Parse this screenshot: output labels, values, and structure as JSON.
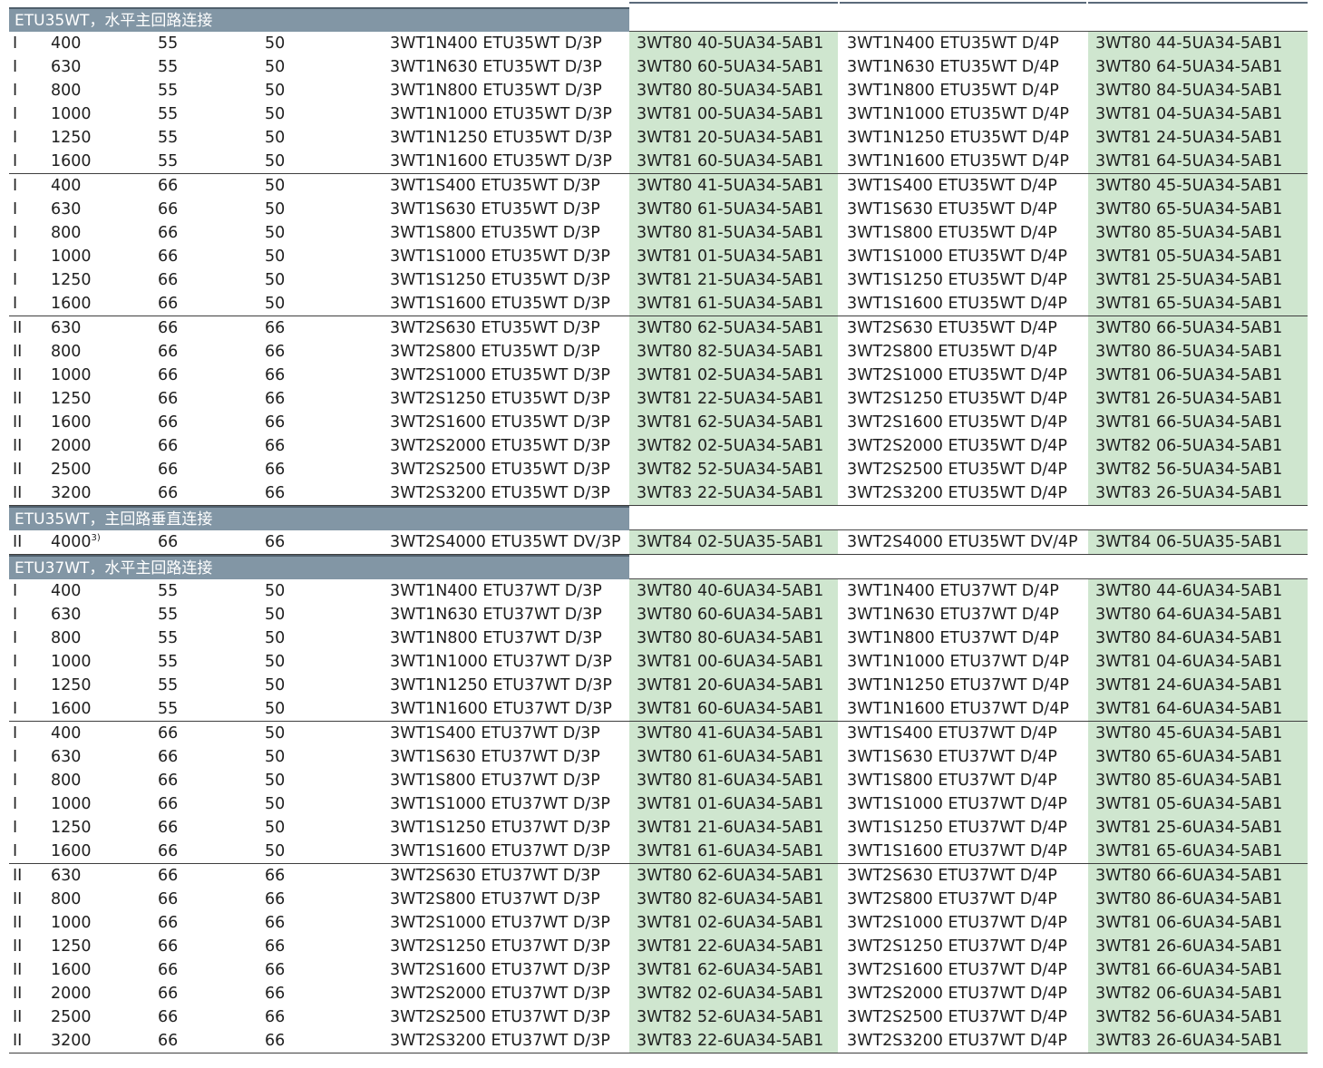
{
  "sections": [
    {
      "title": "ETU35WT，水平主回路连接",
      "groups": [
        [
          [
            "I",
            "400",
            "55",
            "50",
            "3WT1N400 ETU35WT D/3P",
            "3WT80 40-5UA34-5AB1",
            "3WT1N400 ETU35WT D/4P",
            "3WT80 44-5UA34-5AB1"
          ],
          [
            "I",
            "630",
            "55",
            "50",
            "3WT1N630 ETU35WT D/3P",
            "3WT80 60-5UA34-5AB1",
            "3WT1N630 ETU35WT D/4P",
            "3WT80 64-5UA34-5AB1"
          ],
          [
            "I",
            "800",
            "55",
            "50",
            "3WT1N800 ETU35WT D/3P",
            "3WT80 80-5UA34-5AB1",
            "3WT1N800 ETU35WT D/4P",
            "3WT80 84-5UA34-5AB1"
          ],
          [
            "I",
            "1000",
            "55",
            "50",
            "3WT1N1000 ETU35WT D/3P",
            "3WT81 00-5UA34-5AB1",
            "3WT1N1000 ETU35WT D/4P",
            "3WT81 04-5UA34-5AB1"
          ],
          [
            "I",
            "1250",
            "55",
            "50",
            "3WT1N1250 ETU35WT D/3P",
            "3WT81 20-5UA34-5AB1",
            "3WT1N1250 ETU35WT D/4P",
            "3WT81 24-5UA34-5AB1"
          ],
          [
            "I",
            "1600",
            "55",
            "50",
            "3WT1N1600 ETU35WT D/3P",
            "3WT81 60-5UA34-5AB1",
            "3WT1N1600 ETU35WT D/4P",
            "3WT81 64-5UA34-5AB1"
          ]
        ],
        [
          [
            "I",
            "400",
            "66",
            "50",
            "3WT1S400 ETU35WT D/3P",
            "3WT80 41-5UA34-5AB1",
            "3WT1S400 ETU35WT D/4P",
            "3WT80 45-5UA34-5AB1"
          ],
          [
            "I",
            "630",
            "66",
            "50",
            "3WT1S630 ETU35WT D/3P",
            "3WT80 61-5UA34-5AB1",
            "3WT1S630 ETU35WT D/4P",
            "3WT80 65-5UA34-5AB1"
          ],
          [
            "I",
            "800",
            "66",
            "50",
            "3WT1S800 ETU35WT D/3P",
            "3WT80 81-5UA34-5AB1",
            "3WT1S800 ETU35WT D/4P",
            "3WT80 85-5UA34-5AB1"
          ],
          [
            "I",
            "1000",
            "66",
            "50",
            "3WT1S1000 ETU35WT D/3P",
            "3WT81 01-5UA34-5AB1",
            "3WT1S1000 ETU35WT D/4P",
            "3WT81 05-5UA34-5AB1"
          ],
          [
            "I",
            "1250",
            "66",
            "50",
            "3WT1S1250 ETU35WT D/3P",
            "3WT81 21-5UA34-5AB1",
            "3WT1S1250 ETU35WT D/4P",
            "3WT81 25-5UA34-5AB1"
          ],
          [
            "I",
            "1600",
            "66",
            "50",
            "3WT1S1600 ETU35WT D/3P",
            "3WT81 61-5UA34-5AB1",
            "3WT1S1600 ETU35WT D/4P",
            "3WT81 65-5UA34-5AB1"
          ]
        ],
        [
          [
            "II",
            "630",
            "66",
            "66",
            "3WT2S630 ETU35WT D/3P",
            "3WT80 62-5UA34-5AB1",
            "3WT2S630 ETU35WT D/4P",
            "3WT80 66-5UA34-5AB1"
          ],
          [
            "II",
            "800",
            "66",
            "66",
            "3WT2S800 ETU35WT D/3P",
            "3WT80 82-5UA34-5AB1",
            "3WT2S800 ETU35WT D/4P",
            "3WT80 86-5UA34-5AB1"
          ],
          [
            "II",
            "1000",
            "66",
            "66",
            "3WT2S1000 ETU35WT D/3P",
            "3WT81 02-5UA34-5AB1",
            "3WT2S1000 ETU35WT D/4P",
            "3WT81 06-5UA34-5AB1"
          ],
          [
            "II",
            "1250",
            "66",
            "66",
            "3WT2S1250 ETU35WT D/3P",
            "3WT81 22-5UA34-5AB1",
            "3WT2S1250 ETU35WT D/4P",
            "3WT81 26-5UA34-5AB1"
          ],
          [
            "II",
            "1600",
            "66",
            "66",
            "3WT2S1600 ETU35WT D/3P",
            "3WT81 62-5UA34-5AB1",
            "3WT2S1600 ETU35WT D/4P",
            "3WT81 66-5UA34-5AB1"
          ],
          [
            "II",
            "2000",
            "66",
            "66",
            "3WT2S2000 ETU35WT D/3P",
            "3WT82 02-5UA34-5AB1",
            "3WT2S2000 ETU35WT D/4P",
            "3WT82 06-5UA34-5AB1"
          ],
          [
            "II",
            "2500",
            "66",
            "66",
            "3WT2S2500 ETU35WT D/3P",
            "3WT82 52-5UA34-5AB1",
            "3WT2S2500 ETU35WT D/4P",
            "3WT82 56-5UA34-5AB1"
          ],
          [
            "II",
            "3200",
            "66",
            "66",
            "3WT2S3200 ETU35WT D/3P",
            "3WT83 22-5UA34-5AB1",
            "3WT2S3200 ETU35WT D/4P",
            "3WT83 26-5UA34-5AB1"
          ]
        ]
      ]
    },
    {
      "title": "ETU35WT，主回路垂直连接",
      "groups": [
        [
          [
            "II",
            "4000",
            "66",
            "66",
            "3WT2S4000 ETU35WT DV/3P",
            "3WT84 02-5UA35-5AB1",
            "3WT2S4000 ETU35WT DV/4P",
            "3WT84 06-5UA35-5AB1"
          ]
        ]
      ]
    },
    {
      "title": "ETU37WT，水平主回路连接",
      "groups": [
        [
          [
            "I",
            "400",
            "55",
            "50",
            "3WT1N400 ETU37WT D/3P",
            "3WT80 40-6UA34-5AB1",
            "3WT1N400 ETU37WT D/4P",
            "3WT80 44-6UA34-5AB1"
          ],
          [
            "I",
            "630",
            "55",
            "50",
            "3WT1N630 ETU37WT D/3P",
            "3WT80 60-6UA34-5AB1",
            "3WT1N630 ETU37WT D/4P",
            "3WT80 64-6UA34-5AB1"
          ],
          [
            "I",
            "800",
            "55",
            "50",
            "3WT1N800 ETU37WT D/3P",
            "3WT80 80-6UA34-5AB1",
            "3WT1N800 ETU37WT D/4P",
            "3WT80 84-6UA34-5AB1"
          ],
          [
            "I",
            "1000",
            "55",
            "50",
            "3WT1N1000 ETU37WT D/3P",
            "3WT81 00-6UA34-5AB1",
            "3WT1N1000 ETU37WT D/4P",
            "3WT81 04-6UA34-5AB1"
          ],
          [
            "I",
            "1250",
            "55",
            "50",
            "3WT1N1250 ETU37WT D/3P",
            "3WT81 20-6UA34-5AB1",
            "3WT1N1250 ETU37WT D/4P",
            "3WT81 24-6UA34-5AB1"
          ],
          [
            "I",
            "1600",
            "55",
            "50",
            "3WT1N1600 ETU37WT D/3P",
            "3WT81 60-6UA34-5AB1",
            "3WT1N1600 ETU37WT D/4P",
            "3WT81 64-6UA34-5AB1"
          ]
        ],
        [
          [
            "I",
            "400",
            "66",
            "50",
            "3WT1S400 ETU37WT D/3P",
            "3WT80 41-6UA34-5AB1",
            "3WT1S400 ETU37WT D/4P",
            "3WT80 45-6UA34-5AB1"
          ],
          [
            "I",
            "630",
            "66",
            "50",
            "3WT1S630 ETU37WT D/3P",
            "3WT80 61-6UA34-5AB1",
            "3WT1S630 ETU37WT D/4P",
            "3WT80 65-6UA34-5AB1"
          ],
          [
            "I",
            "800",
            "66",
            "50",
            "3WT1S800 ETU37WT D/3P",
            "3WT80 81-6UA34-5AB1",
            "3WT1S800 ETU37WT D/4P",
            "3WT80 85-6UA34-5AB1"
          ],
          [
            "I",
            "1000",
            "66",
            "50",
            "3WT1S1000 ETU37WT D/3P",
            "3WT81 01-6UA34-5AB1",
            "3WT1S1000 ETU37WT D/4P",
            "3WT81 05-6UA34-5AB1"
          ],
          [
            "I",
            "1250",
            "66",
            "50",
            "3WT1S1250 ETU37WT D/3P",
            "3WT81 21-6UA34-5AB1",
            "3WT1S1250 ETU37WT D/4P",
            "3WT81 25-6UA34-5AB1"
          ],
          [
            "I",
            "1600",
            "66",
            "50",
            "3WT1S1600 ETU37WT D/3P",
            "3WT81 61-6UA34-5AB1",
            "3WT1S1600 ETU37WT D/4P",
            "3WT81 65-6UA34-5AB1"
          ]
        ],
        [
          [
            "II",
            "630",
            "66",
            "66",
            "3WT2S630 ETU37WT D/3P",
            "3WT80 62-6UA34-5AB1",
            "3WT2S630 ETU37WT D/4P",
            "3WT80 66-6UA34-5AB1"
          ],
          [
            "II",
            "800",
            "66",
            "66",
            "3WT2S800 ETU37WT D/3P",
            "3WT80 82-6UA34-5AB1",
            "3WT2S800 ETU37WT D/4P",
            "3WT80 86-6UA34-5AB1"
          ],
          [
            "II",
            "1000",
            "66",
            "66",
            "3WT2S1000 ETU37WT D/3P",
            "3WT81 02-6UA34-5AB1",
            "3WT2S1000 ETU37WT D/4P",
            "3WT81 06-6UA34-5AB1"
          ],
          [
            "II",
            "1250",
            "66",
            "66",
            "3WT2S1250 ETU37WT D/3P",
            "3WT81 22-6UA34-5AB1",
            "3WT2S1250 ETU37WT D/4P",
            "3WT81 26-6UA34-5AB1"
          ],
          [
            "II",
            "1600",
            "66",
            "66",
            "3WT2S1600 ETU37WT D/3P",
            "3WT81 62-6UA34-5AB1",
            "3WT2S1600 ETU37WT D/4P",
            "3WT81 66-6UA34-5AB1"
          ],
          [
            "II",
            "2000",
            "66",
            "66",
            "3WT2S2000 ETU37WT D/3P",
            "3WT82 02-6UA34-5AB1",
            "3WT2S2000 ETU37WT D/4P",
            "3WT82 06-6UA34-5AB1"
          ],
          [
            "II",
            "2500",
            "66",
            "66",
            "3WT2S2500 ETU37WT D/3P",
            "3WT82 52-6UA34-5AB1",
            "3WT2S2500 ETU37WT D/4P",
            "3WT82 56-6UA34-5AB1"
          ],
          [
            "II",
            "3200",
            "66",
            "66",
            "3WT2S3200 ETU37WT D/3P",
            "3WT83 22-6UA34-5AB1",
            "3WT2S3200 ETU37WT D/4P",
            "3WT83 26-6UA34-5AB1"
          ]
        ]
      ]
    }
  ],
  "footnote_marker": "3)",
  "colors": {
    "section_header_bg": "#8296a5",
    "order_number_bg": "#cfe6cf",
    "rule": "#3e3e3e"
  }
}
